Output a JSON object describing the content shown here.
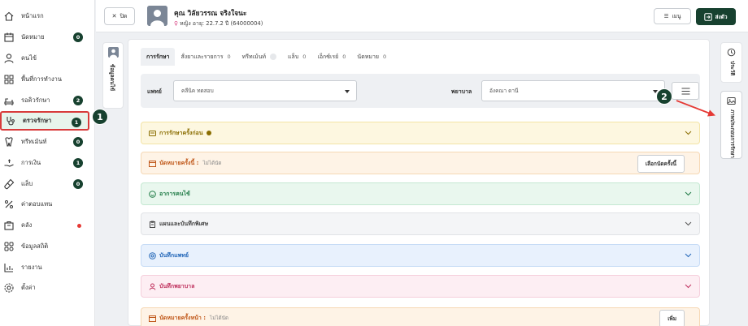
{
  "sidebar": {
    "items": [
      {
        "label": "หน้าแรก",
        "icon": "home-icon",
        "badge": ""
      },
      {
        "label": "นัดหมาย",
        "icon": "calendar-icon",
        "badge": "0"
      },
      {
        "label": "คนไข้",
        "icon": "user-icon",
        "badge": ""
      },
      {
        "label": "พื้นที่การทำงาน",
        "icon": "grid-icon",
        "badge": ""
      },
      {
        "label": "รอคิวรักษา",
        "icon": "chair-icon",
        "badge": "2"
      },
      {
        "label": "ตรวจรักษา",
        "icon": "stethoscope-icon",
        "badge": "1"
      },
      {
        "label": "ทรีทเม้นท์",
        "icon": "treatment-icon",
        "badge": "0"
      },
      {
        "label": "การเงิน",
        "icon": "money-hand-icon",
        "badge": "1"
      },
      {
        "label": "แล็บ",
        "icon": "lab-tube-icon",
        "badge": "0"
      },
      {
        "label": "ค่าตอบแทน",
        "icon": "percent-icon",
        "badge": ""
      },
      {
        "label": "คลัง",
        "icon": "store-icon",
        "badge": ""
      },
      {
        "label": "ข้อมูลสถิติ",
        "icon": "stats-icon",
        "badge": ""
      },
      {
        "label": "รายงาน",
        "icon": "report-icon",
        "badge": ""
      },
      {
        "label": "ตั้งค่า",
        "icon": "gear-icon",
        "badge": ""
      }
    ],
    "active_index": 5
  },
  "callouts": {
    "one": "1",
    "two": "2"
  },
  "header": {
    "close_label": "ปิด",
    "patient_name": "คุณ วิลัยวรรณ จริงใจนะ",
    "gender": "หญิง",
    "age_info": "อายุ: 22.7.2 ปี  (64000004)",
    "menu_label": "เมนู",
    "send_label": "ส่งตัว"
  },
  "left_panel": {
    "label": "ข้อมูลคนไข้"
  },
  "tabs": [
    {
      "label": "การรักษา",
      "count": ""
    },
    {
      "label": "สั่งยาและรายการ",
      "count": "0"
    },
    {
      "label": "ทรีทเม้นท์",
      "count": ""
    },
    {
      "label": "แล็บ",
      "count": "0"
    },
    {
      "label": "เอ็กซ์เรย์",
      "count": "0"
    },
    {
      "label": "นัดหมาย",
      "count": "0"
    }
  ],
  "filters": {
    "doctor_label": "แพทย์",
    "doctor_value": "คลีนิค ทดสอบ",
    "nurse_label": "พยาบาล",
    "nurse_value": "อังคณา ดานี"
  },
  "sections": {
    "prev_treatment": "การรักษาครั้งก่อน",
    "this_appt": "นัดหมายครั้งนี้ :",
    "this_appt_sub": "ไม่ได้นัด",
    "this_appt_btn": "เลือกนัดครั้งนี้",
    "symptoms": "อาการคนไข้",
    "plan": "แผนและบันทึกพิเศษ",
    "doctor_note": "บันทึกแพทย์",
    "nurse_note": "บันทึกพยาบาล",
    "next_appt": "นัดหมายครั้งหน้า :",
    "next_appt_sub": "ไม่ได้นัด",
    "next_appt_btn": "เพิ่ม"
  },
  "right_panel": {
    "history_label": "ประวัติ",
    "images_label": "ภาพประกอบการรักษา"
  },
  "colors": {
    "brand": "#17412f",
    "highlight": "#d83b3b",
    "prev_bg": "#fdf7e0",
    "appt_bg": "#fef3e6",
    "symptom_bg": "#e9f7ee",
    "doctor_bg": "#e8f1fd",
    "nurse_bg": "#fdeef3"
  }
}
